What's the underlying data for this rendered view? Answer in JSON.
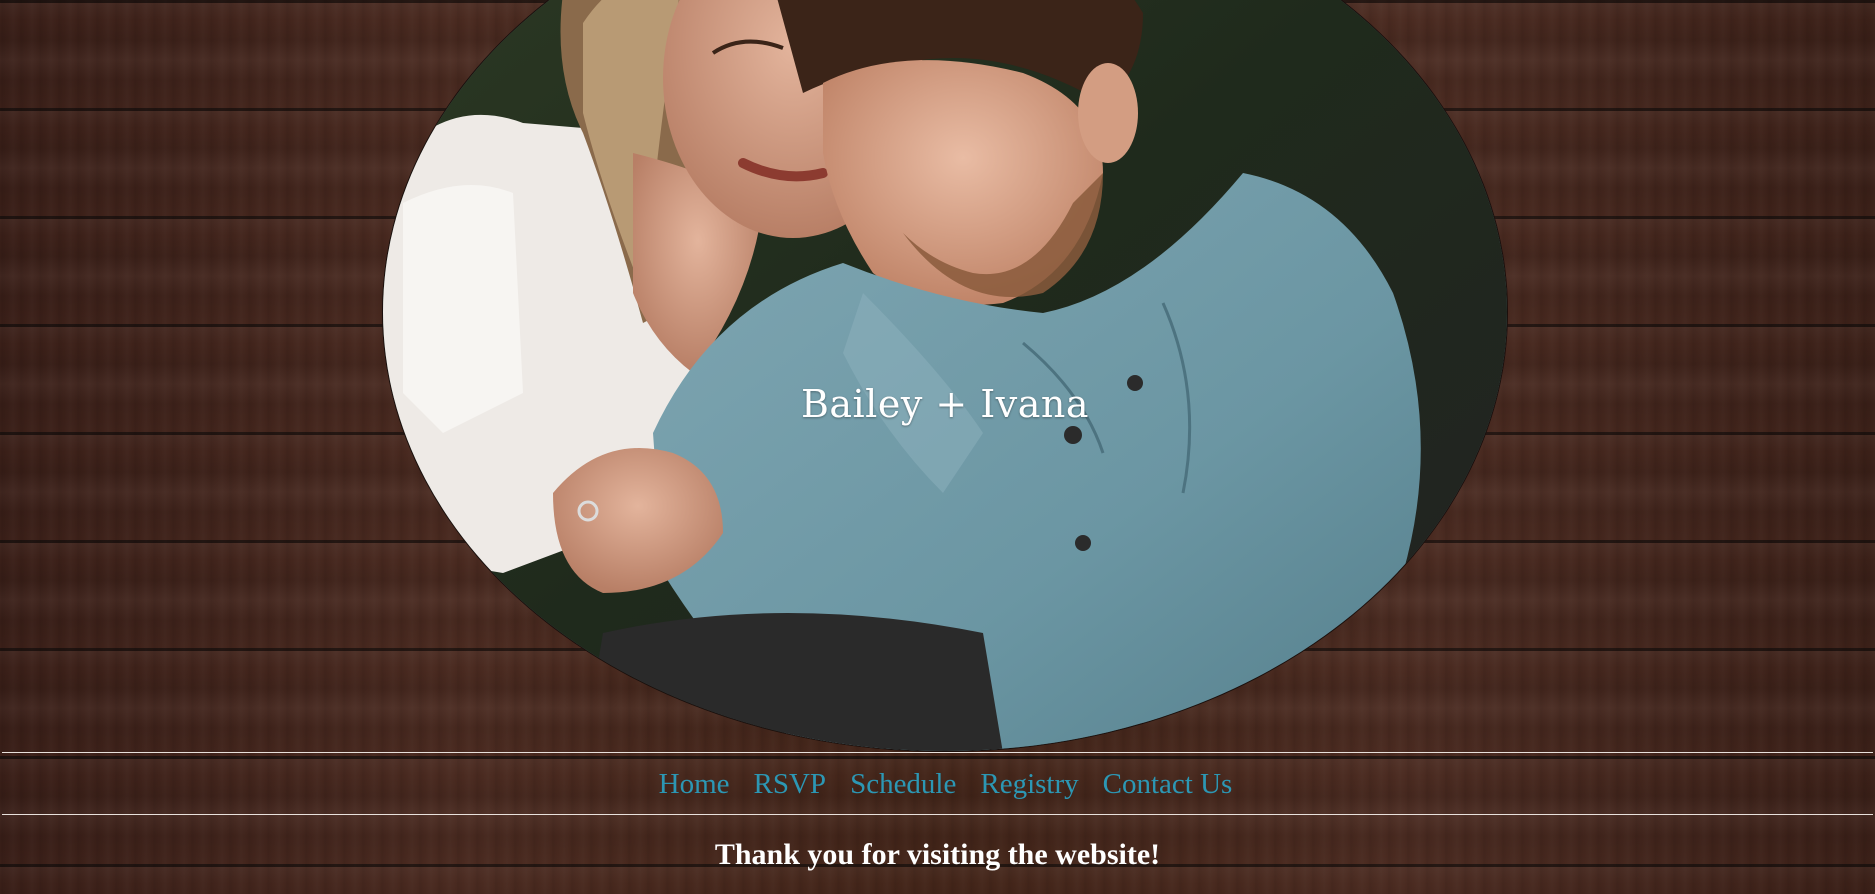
{
  "hero": {
    "title": "Bailey + Ivana",
    "photo_icon": "couple-photo"
  },
  "nav": {
    "items": [
      {
        "label": "Home"
      },
      {
        "label": "RSVP"
      },
      {
        "label": "Schedule"
      },
      {
        "label": "Registry"
      },
      {
        "label": "Contact Us"
      }
    ]
  },
  "footer": {
    "message": "Thank you for visiting the website!"
  },
  "colors": {
    "nav_link": "#2c97b4",
    "rule": "#e9e1dc",
    "title_text": "#ffffff",
    "wood_base": "#432519"
  }
}
